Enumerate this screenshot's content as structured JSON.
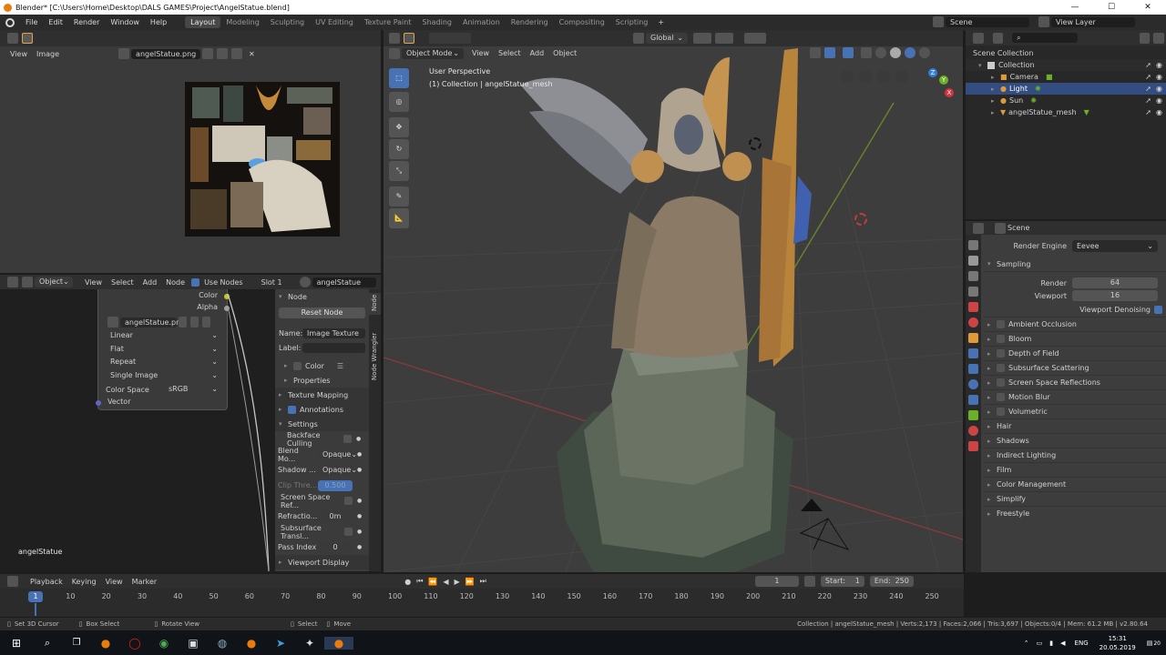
{
  "window": {
    "title": "Blender* [C:\\Users\\Home\\Desktop\\DALS GAMES\\Project\\AngelStatue.blend]",
    "min": "—",
    "max": "☐",
    "close": "✕"
  },
  "topmenu": {
    "items": [
      "File",
      "Edit",
      "Render",
      "Window",
      "Help"
    ]
  },
  "workspaces": [
    "Layout",
    "Modeling",
    "Sculpting",
    "UV Editing",
    "Texture Paint",
    "Shading",
    "Animation",
    "Rendering",
    "Compositing",
    "Scripting"
  ],
  "scene_field": "Scene",
  "view_layer_field": "View Layer",
  "image_editor": {
    "view": "View",
    "image": "Image",
    "image_name": "angelStatue.png"
  },
  "node_editor": {
    "object": "Object",
    "view": "View",
    "select": "Select",
    "add": "Add",
    "node": "Node",
    "use_nodes": "Use Nodes",
    "slot": "Slot 1",
    "material": "angelStatue",
    "footer_label": "angelStatue",
    "sockets": {
      "color": "Color",
      "alpha": "Alpha",
      "vector": "Vector"
    },
    "texture_node": {
      "image": "angelStatue.png",
      "interpolation": "Linear",
      "projection": "Flat",
      "extension": "Repeat",
      "source": "Single Image",
      "color_space_label": "Color Space",
      "color_space": "sRGB"
    }
  },
  "sidebar": {
    "tab_node": "Node",
    "tab_wrangler": "Node Wrangler",
    "header": "Node",
    "reset_node": "Reset Node",
    "name_label": "Name:",
    "name_value": "Image Texture",
    "label_label": "Label:",
    "color": "Color",
    "properties": "Properties",
    "texture_mapping": "Texture Mapping",
    "annotations": "Annotations",
    "settings": "Settings",
    "backface": "Backface Culling",
    "blend_label": "Blend Mo...",
    "blend_value": "Opaque",
    "shadow_label": "Shadow ...",
    "shadow_value": "Opaque",
    "clip_label": "Clip Thre...",
    "clip_value": "0.500",
    "ssr": "Screen Space Ref...",
    "refraction_label": "Refractio...",
    "refraction_value": "0m",
    "subsurface": "Subsurface Transl...",
    "pass_label": "Pass Index",
    "pass_value": "0",
    "viewport_display": "Viewport Display"
  },
  "viewport": {
    "mode": "Object Mode",
    "view": "View",
    "select": "Select",
    "add": "Add",
    "object": "Object",
    "orientation": "Global",
    "info_line1": "User Perspective",
    "info_line2": "(1) Collection | angelStatue_mesh",
    "gizmo_x": "X",
    "gizmo_y": "Y",
    "gizmo_z": "Z"
  },
  "outliner": {
    "root": "Scene Collection",
    "items": [
      {
        "label": "Collection",
        "color": "#cfcfcf"
      },
      {
        "label": "Camera",
        "color": "#cfcfcf"
      },
      {
        "label": "Light",
        "color": "#cfcfcf"
      },
      {
        "label": "Sun",
        "color": "#cfcfcf"
      },
      {
        "label": "angelStatue_mesh",
        "color": "#cfcfcf"
      }
    ]
  },
  "properties": {
    "tab_label": "Scene",
    "render_engine_label": "Render Engine",
    "render_engine": "Eevee",
    "sampling": "Sampling",
    "render_label": "Render",
    "render_value": "64",
    "viewport_label": "Viewport",
    "viewport_value": "16",
    "denoise": "Viewport Denoising",
    "checked_sections": [
      "Ambient Occlusion",
      "Bloom",
      "Depth of Field",
      "Subsurface Scattering",
      "Screen Space Reflections",
      "Motion Blur",
      "Volumetric"
    ],
    "sections": [
      "Hair",
      "Shadows",
      "Indirect Lighting",
      "Film",
      "Color Management",
      "Simplify",
      "Freestyle"
    ]
  },
  "timeline": {
    "playback": "Playback",
    "keying": "Keying",
    "view": "View",
    "marker": "Marker",
    "current_frame": "1",
    "start_label": "Start:",
    "start": "1",
    "end_label": "End:",
    "end": "250",
    "ticks": [
      "1",
      "10",
      "20",
      "30",
      "40",
      "50",
      "60",
      "70",
      "80",
      "90",
      "100",
      "110",
      "120",
      "130",
      "140",
      "150",
      "160",
      "170",
      "180",
      "190",
      "200",
      "210",
      "220",
      "230",
      "240",
      "250"
    ],
    "cursor_frame": "1"
  },
  "statusbar": {
    "cursor": "Set 3D Cursor",
    "box": "Box Select",
    "rotate": "Rotate View",
    "select": "Select",
    "move": "Move",
    "stats": "Collection | angelStatue_mesh | Verts:2,173 | Faces:2,066 | Tris:3,697 | Objects:0/4 | Mem: 61.2 MB | v2.80.64"
  },
  "taskbar": {
    "lang": "ENG",
    "time": "15:31",
    "date": "20.05.2019",
    "badge": "20"
  },
  "colors": {
    "accent": "#4772b3",
    "selected_row": "#334d80"
  }
}
